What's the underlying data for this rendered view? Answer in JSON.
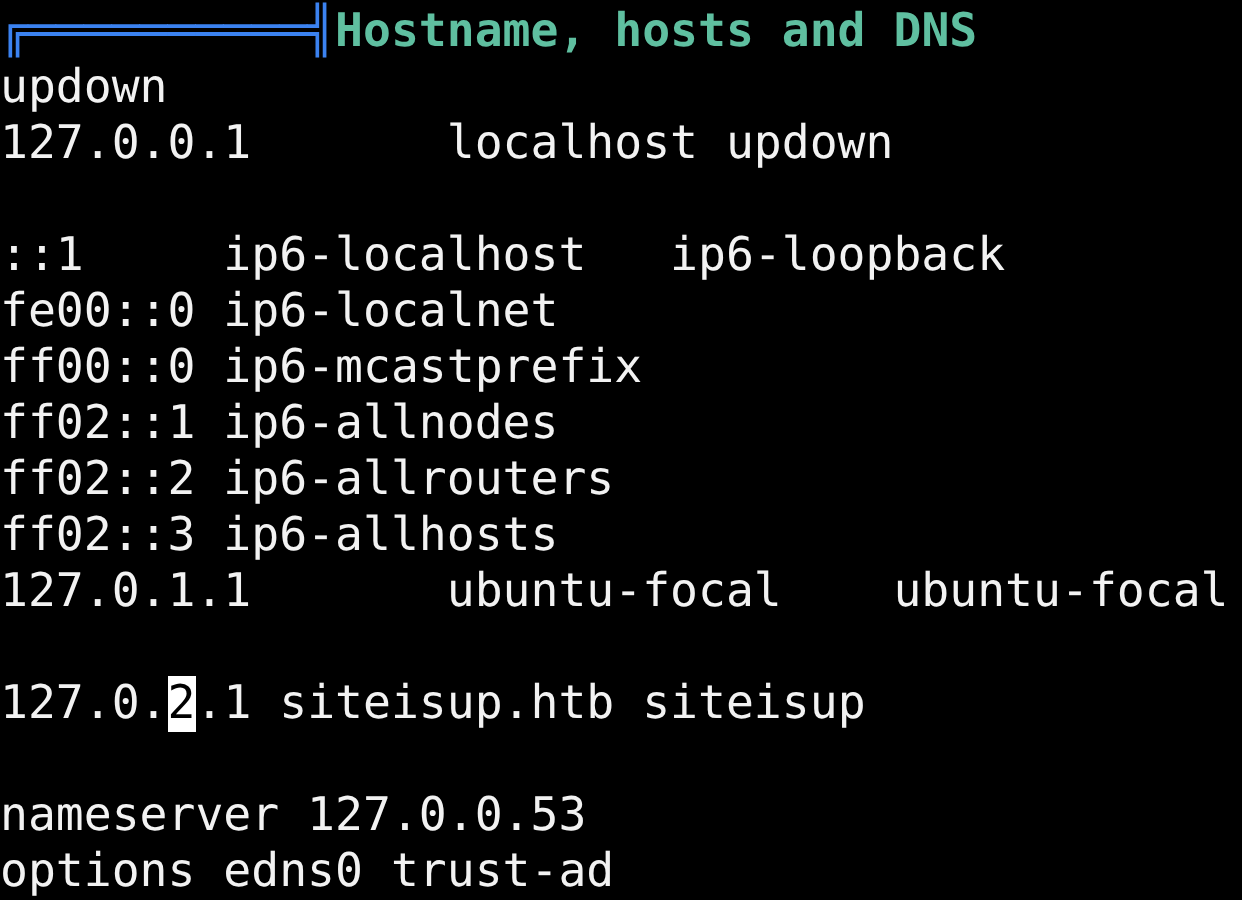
{
  "header": {
    "rule": "╔══════════╣",
    "title": "Hostname, hosts and DNS"
  },
  "lines": [
    {
      "kind": "text",
      "text": "updown"
    },
    {
      "kind": "text",
      "text": "127.0.0.1       localhost updown"
    },
    {
      "kind": "blank"
    },
    {
      "kind": "text",
      "text": "::1     ip6-localhost   ip6-loopback"
    },
    {
      "kind": "text",
      "text": "fe00::0 ip6-localnet"
    },
    {
      "kind": "text",
      "text": "ff00::0 ip6-mcastprefix"
    },
    {
      "kind": "text",
      "text": "ff02::1 ip6-allnodes"
    },
    {
      "kind": "text",
      "text": "ff02::2 ip6-allrouters"
    },
    {
      "kind": "text",
      "text": "ff02::3 ip6-allhosts"
    },
    {
      "kind": "text",
      "text": "127.0.1.1       ubuntu-focal    ubuntu-focal"
    },
    {
      "kind": "blank"
    },
    {
      "kind": "cursor",
      "before": "127.0.",
      "cursor": "2",
      "after": ".1 siteisup.htb siteisup"
    },
    {
      "kind": "blank"
    },
    {
      "kind": "text",
      "text": "nameserver 127.0.0.53"
    },
    {
      "kind": "text",
      "text": "options edns0 trust-ad"
    }
  ]
}
